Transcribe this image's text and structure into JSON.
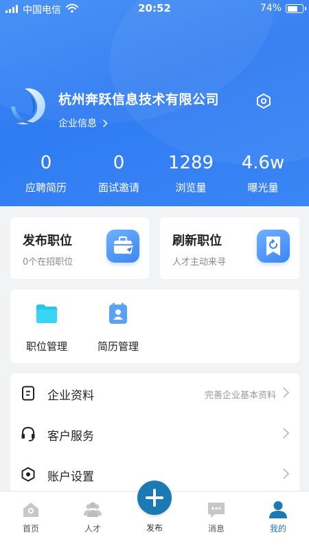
{
  "status_bar": {
    "carrier": "中国电信",
    "time": "20:52",
    "battery_percent": "74%",
    "battery_level": 0.74
  },
  "company": {
    "name": "杭州奔跃信息技术有限公司",
    "info_link": "企业信息"
  },
  "stats": [
    {
      "value": "0",
      "label": "应聘简历"
    },
    {
      "value": "0",
      "label": "面试邀请"
    },
    {
      "value": "1289",
      "label": "浏览量"
    },
    {
      "value": "4.6w",
      "label": "曝光量"
    }
  ],
  "actions": {
    "publish": {
      "title": "发布职位",
      "sub": "0个在招职位",
      "icon": "briefcase-icon"
    },
    "refresh": {
      "title": "刷新职位",
      "sub": "人才主动来寻",
      "icon": "refresh-bookmark-icon"
    }
  },
  "management": [
    {
      "label": "职位管理",
      "icon": "folder-icon"
    },
    {
      "label": "简历管理",
      "icon": "resume-icon"
    }
  ],
  "menu": [
    {
      "label": "企业资料",
      "hint": "完善企业基本资料",
      "icon": "document-icon"
    },
    {
      "label": "客户服务",
      "hint": "",
      "icon": "headset-icon"
    },
    {
      "label": "账户设置",
      "hint": "",
      "icon": "hexagon-settings-icon"
    }
  ],
  "tabbar": {
    "tabs": [
      {
        "label": "首页",
        "icon": "home-icon"
      },
      {
        "label": "人才",
        "icon": "people-icon"
      },
      {
        "label": "消息",
        "icon": "message-icon"
      },
      {
        "label": "我的",
        "icon": "profile-icon"
      }
    ],
    "publish_label": "发布",
    "active": "我的"
  },
  "colors": {
    "header": "#3a86f5",
    "accent": "#1b7ab4",
    "background": "#f2f3f5"
  }
}
